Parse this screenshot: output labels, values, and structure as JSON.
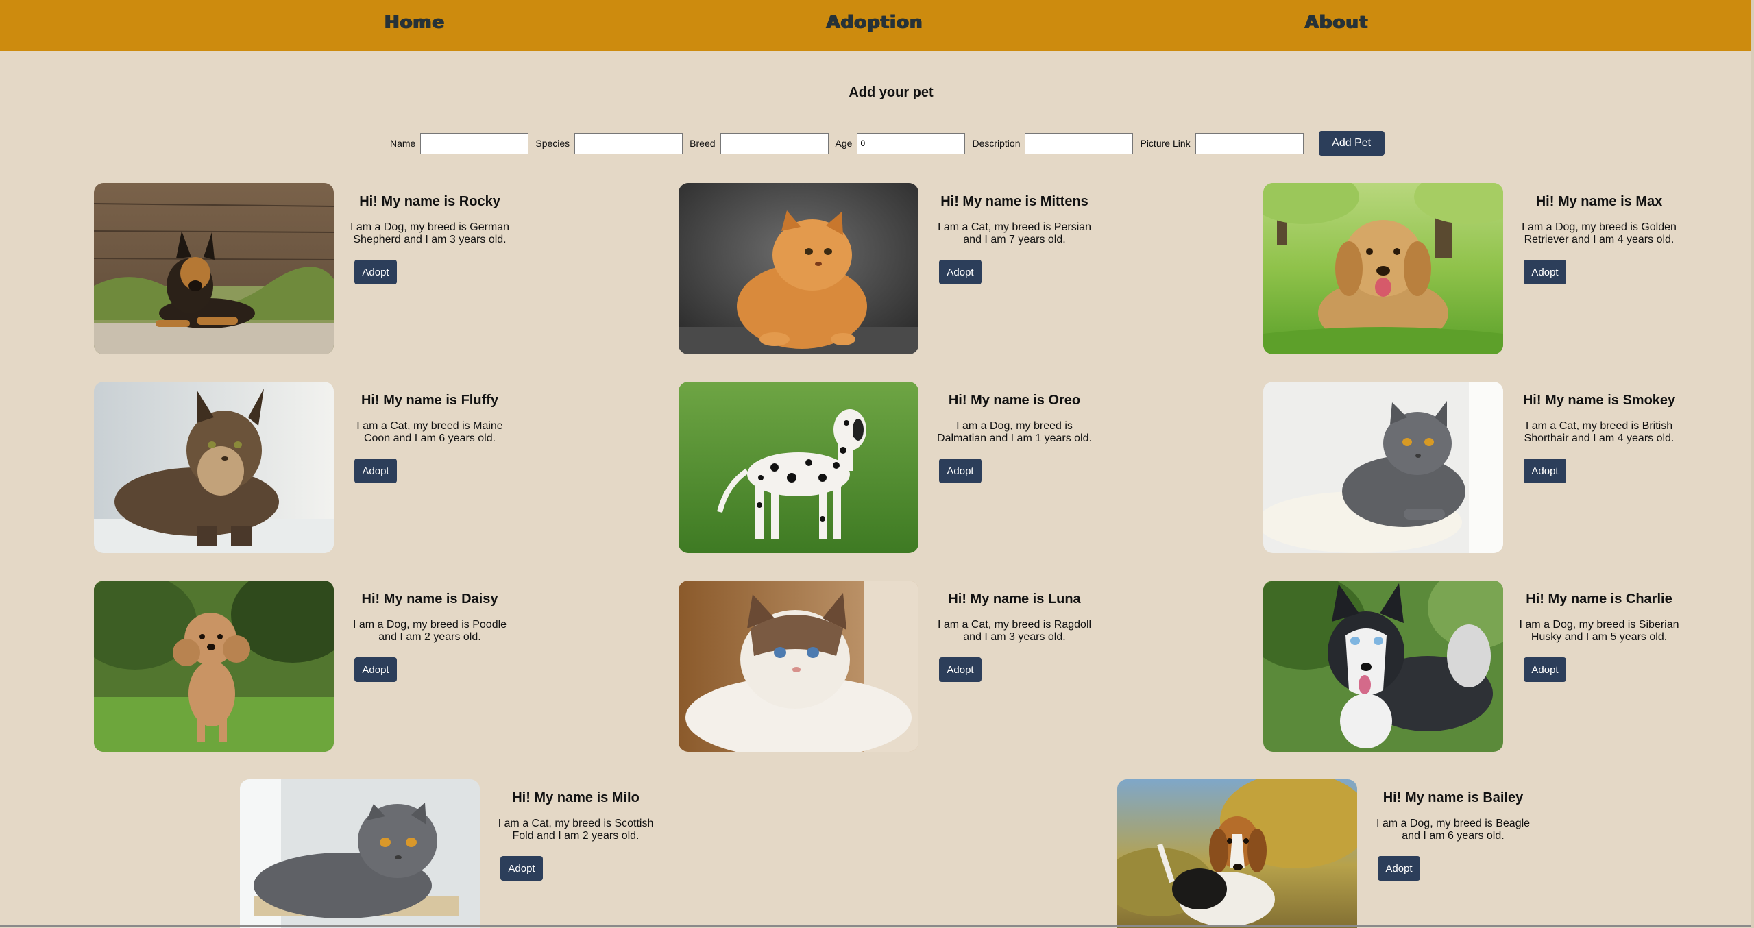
{
  "nav": {
    "home": "Home",
    "adoption": "Adoption",
    "about": "About"
  },
  "form": {
    "title": "Add your pet",
    "fields": {
      "name": {
        "label": "Name",
        "value": ""
      },
      "species": {
        "label": "Species",
        "value": ""
      },
      "breed": {
        "label": "Breed",
        "value": ""
      },
      "age": {
        "label": "Age",
        "value": "0"
      },
      "description": {
        "label": "Description",
        "value": ""
      },
      "picture": {
        "label": "Picture Link",
        "value": ""
      }
    },
    "submit_label": "Add Pet"
  },
  "pets": [
    {
      "title": "Hi! My name is Rocky",
      "text": "I am a Dog, my breed is German Shepherd and I am 3 years old.",
      "adopt": "Adopt"
    },
    {
      "title": "Hi! My name is Mittens",
      "text": "I am a Cat, my breed is Persian and I am 7 years old.",
      "adopt": "Adopt"
    },
    {
      "title": "Hi! My name is Max",
      "text": "I am a Dog, my breed is Golden Retriever and I am 4 years old.",
      "adopt": "Adopt"
    },
    {
      "title": "Hi! My name is Fluffy",
      "text": "I am a Cat, my breed is Maine Coon and I am 6 years old.",
      "adopt": "Adopt"
    },
    {
      "title": "Hi! My name is Oreo",
      "text": "I am a Dog, my breed is Dalmatian and I am 1 years old.",
      "adopt": "Adopt"
    },
    {
      "title": "Hi! My name is Smokey",
      "text": "I am a Cat, my breed is British Shorthair and I am 4 years old.",
      "adopt": "Adopt"
    },
    {
      "title": "Hi! My name is Daisy",
      "text": "I am a Dog, my breed is Poodle and I am 2 years old.",
      "adopt": "Adopt"
    },
    {
      "title": "Hi! My name is Luna",
      "text": "I am a Cat, my breed is Ragdoll and I am 3 years old.",
      "adopt": "Adopt"
    },
    {
      "title": "Hi! My name is Charlie",
      "text": "I am a Dog, my breed is Siberian Husky and I am 5 years old.",
      "adopt": "Adopt"
    },
    {
      "title": "Hi! My name is Milo",
      "text": "I am a Cat, my breed is Scottish Fold and I am 2 years old.",
      "adopt": "Adopt"
    },
    {
      "title": "Hi! My name is Bailey",
      "text": "I am a Dog, my breed is Beagle and I am 6 years old.",
      "adopt": "Adopt"
    }
  ]
}
